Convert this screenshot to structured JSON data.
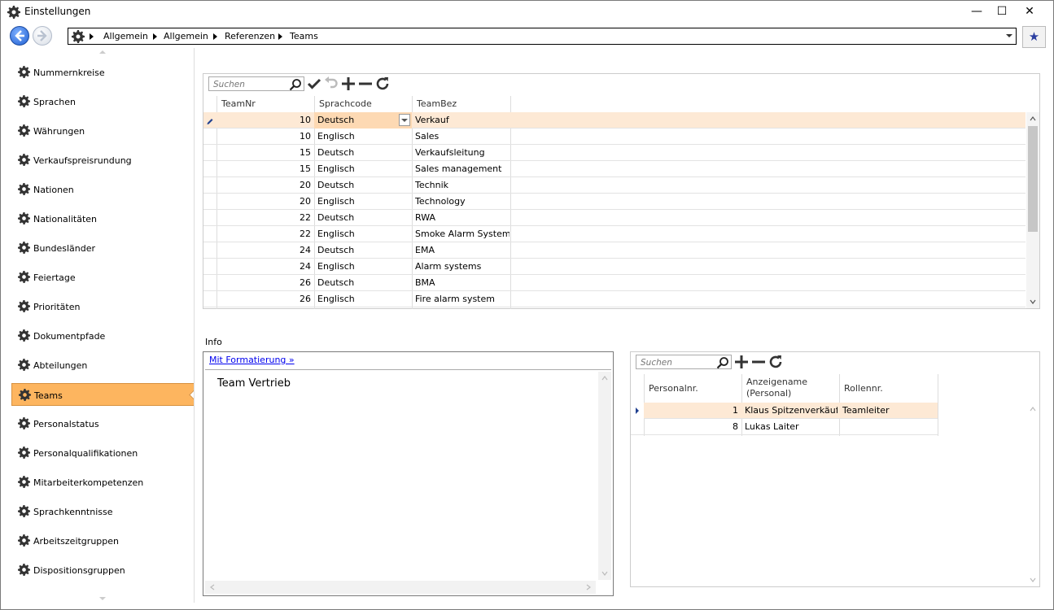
{
  "window": {
    "title": "Einstellungen",
    "min": "—",
    "max": "☐",
    "close": "✕"
  },
  "breadcrumb": [
    "Allgemein",
    "Allgemein",
    "Referenzen",
    "Teams"
  ],
  "sidebar": {
    "items": [
      {
        "label": "Nummernkreise"
      },
      {
        "label": "Sprachen"
      },
      {
        "label": "Währungen"
      },
      {
        "label": "Verkaufspreisrundung"
      },
      {
        "label": "Nationen"
      },
      {
        "label": "Nationalitäten"
      },
      {
        "label": "Bundesländer"
      },
      {
        "label": "Feiertage"
      },
      {
        "label": "Prioritäten"
      },
      {
        "label": "Dokumentpfade"
      },
      {
        "label": "Abteilungen"
      },
      {
        "label": "Teams",
        "active": true
      },
      {
        "label": "Personalstatus"
      },
      {
        "label": "Personalqualifikationen"
      },
      {
        "label": "Mitarbeiterkompetenzen"
      },
      {
        "label": "Sprachkenntnisse"
      },
      {
        "label": "Arbeitszeitgruppen"
      },
      {
        "label": "Dispositionsgruppen"
      }
    ]
  },
  "teams_grid": {
    "search_placeholder": "Suchen",
    "columns": [
      "TeamNr",
      "Sprachcode",
      "TeamBez"
    ],
    "rows": [
      [
        "10",
        "Deutsch",
        "Verkauf"
      ],
      [
        "10",
        "Englisch",
        "Sales"
      ],
      [
        "15",
        "Deutsch",
        "Verkaufsleitung"
      ],
      [
        "15",
        "Englisch",
        "Sales management"
      ],
      [
        "20",
        "Deutsch",
        "Technik"
      ],
      [
        "20",
        "Englisch",
        "Technology"
      ],
      [
        "22",
        "Deutsch",
        "RWA"
      ],
      [
        "22",
        "Englisch",
        "Smoke Alarm Systems"
      ],
      [
        "24",
        "Deutsch",
        "EMA"
      ],
      [
        "24",
        "Englisch",
        "Alarm systems"
      ],
      [
        "26",
        "Deutsch",
        "BMA"
      ],
      [
        "26",
        "Englisch",
        "Fire alarm system"
      ]
    ]
  },
  "info": {
    "label": "Info",
    "format_link": "Mit Formatierung »",
    "text": "Team Vertrieb"
  },
  "members_grid": {
    "search_placeholder": "Suchen",
    "columns": [
      "Personalnr.",
      "Anzeigename\n(Personal)",
      "Rollennr."
    ],
    "rows": [
      [
        "1",
        "Klaus Spitzenverkäufer",
        "Teamleiter"
      ],
      [
        "8",
        "Lukas Laiter",
        ""
      ]
    ]
  },
  "colors": {
    "accent": "#fdb55f",
    "selected_row": "#fde9d5",
    "link": "#0000ee"
  }
}
